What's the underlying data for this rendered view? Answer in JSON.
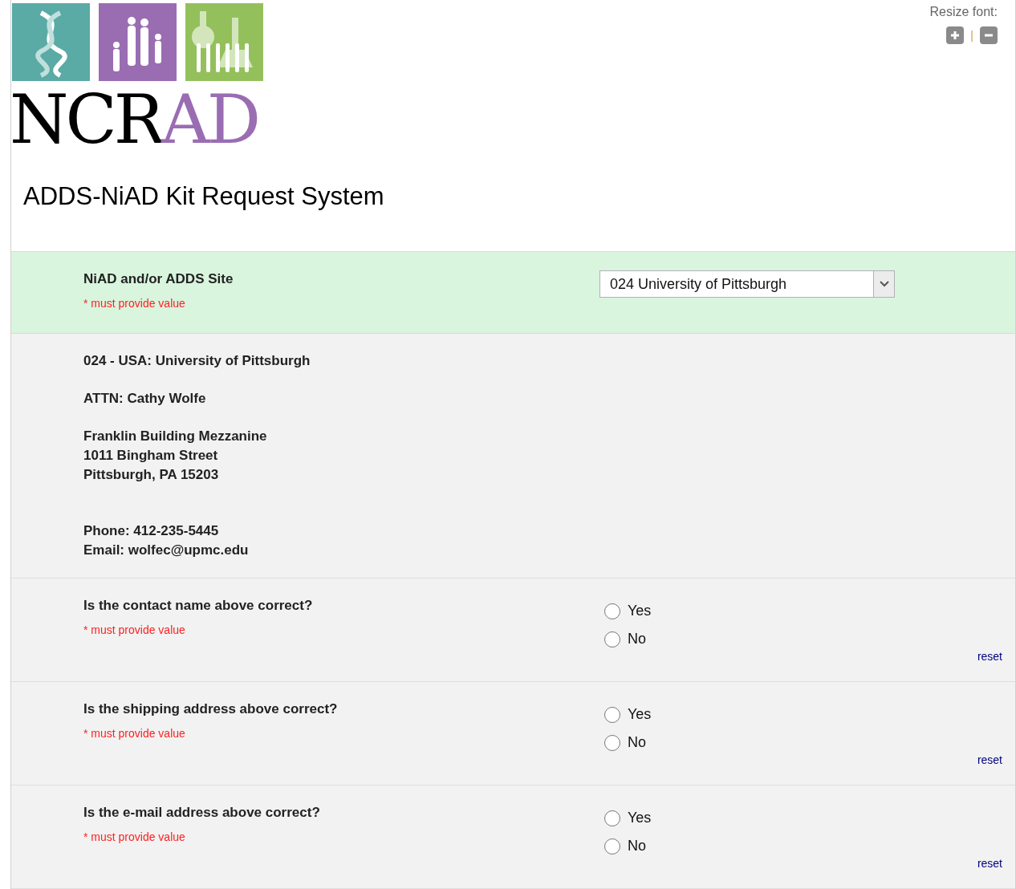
{
  "logo": {
    "dark_text": "NCR",
    "accent_text": "AD"
  },
  "resize_font": {
    "label": "Resize font:",
    "separator": "|"
  },
  "title": "ADDS-NiAD Kit Request System",
  "site_field": {
    "label": "NiAD and/or ADDS Site",
    "required_note": "* must provide value",
    "value": "024 University of Pittsburgh"
  },
  "address_blocks": [
    [
      "024 - USA: University of Pittsburgh"
    ],
    [
      "ATTN: Cathy Wolfe"
    ],
    [
      "Franklin Building Mezzanine",
      "1011 Bingham Street",
      "Pittsburgh, PA 15203"
    ],
    [
      "Phone: 412-235-5445",
      "Email: wolfec@upmc.edu"
    ]
  ],
  "questions": [
    {
      "label": "Is the contact name above correct?",
      "required_note": "* must provide value",
      "options": [
        {
          "label": "Yes",
          "selected": false
        },
        {
          "label": "No",
          "selected": false
        }
      ],
      "reset": "reset"
    },
    {
      "label": "Is the shipping address above correct?",
      "required_note": "* must provide value",
      "options": [
        {
          "label": "Yes",
          "selected": false
        },
        {
          "label": "No",
          "selected": false
        }
      ],
      "reset": "reset"
    },
    {
      "label": "Is the e-mail address above correct?",
      "required_note": "* must provide value",
      "options": [
        {
          "label": "Yes",
          "selected": false
        },
        {
          "label": "No",
          "selected": false
        }
      ],
      "reset": "reset"
    }
  ]
}
